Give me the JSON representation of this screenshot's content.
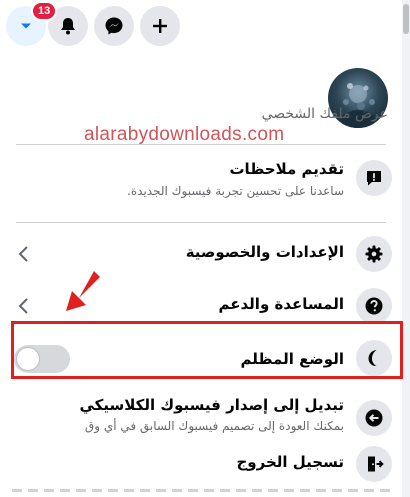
{
  "topbar": {
    "notification_count": "13",
    "icons": [
      "account-caret-icon",
      "bell-icon",
      "messenger-icon",
      "plus-icon"
    ]
  },
  "profile": {
    "view_label": "عرض ملفك الشخصي"
  },
  "watermark": "alarabydownloads.com",
  "menu": {
    "feedback": {
      "label": "تقديم ملاحظات",
      "sub": "ساعدنا على تحسين تجربة فيسبوك الجديدة.",
      "icon": "feedback-exclamation-icon"
    },
    "settings": {
      "label": "الإعدادات والخصوصية",
      "icon": "gear-icon"
    },
    "help": {
      "label": "المساعدة والدعم",
      "icon": "question-icon"
    },
    "dark_mode": {
      "label": "الوضع المظلم",
      "icon": "moon-icon",
      "enabled": false
    },
    "classic": {
      "label": "تبديل إلى إصدار فيسبوك الكلاسيكي",
      "sub": "بمكنك العودة إلى تصميم فيسبوك السابق في أي وق",
      "icon": "switch-arrow-icon"
    },
    "logout": {
      "label": "تسجيل الخروج",
      "icon": "logout-door-icon"
    }
  },
  "colors": {
    "highlight": "#e0201f",
    "badge": "#e41e3f",
    "accent": "#1877f2"
  }
}
